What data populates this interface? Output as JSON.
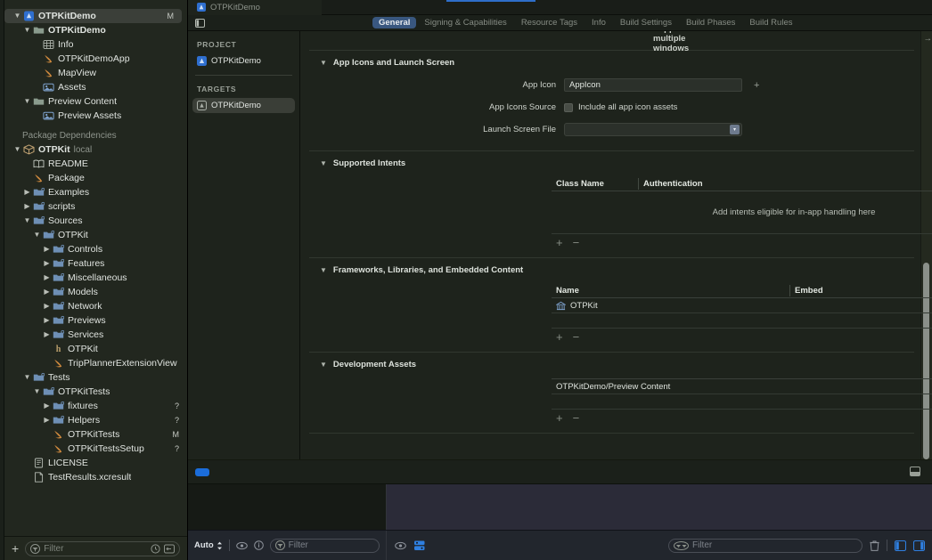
{
  "window": {
    "title": "OTPKitDemo"
  },
  "navigator": {
    "items": [
      {
        "disc": "v",
        "indent": 0,
        "icon": "app-project-icon",
        "label": "OTPKitDemo",
        "status": "M",
        "selected": true,
        "bold": true
      },
      {
        "disc": "v",
        "indent": 1,
        "icon": "folder-icon",
        "label": "OTPKitDemo",
        "status": "",
        "selected": false,
        "bold": true
      },
      {
        "disc": "",
        "indent": 2,
        "icon": "plist-icon",
        "label": "Info",
        "status": "",
        "selected": false,
        "bold": false
      },
      {
        "disc": "",
        "indent": 2,
        "icon": "swift-icon",
        "label": "OTPKitDemoApp",
        "status": "",
        "selected": false,
        "bold": false
      },
      {
        "disc": "",
        "indent": 2,
        "icon": "swift-icon",
        "label": "MapView",
        "status": "",
        "selected": false,
        "bold": false
      },
      {
        "disc": "",
        "indent": 2,
        "icon": "assets-icon",
        "label": "Assets",
        "status": "",
        "selected": false,
        "bold": false
      },
      {
        "disc": "v",
        "indent": 1,
        "icon": "folder-icon",
        "label": "Preview Content",
        "status": "",
        "selected": false,
        "bold": false
      },
      {
        "disc": "",
        "indent": 2,
        "icon": "assets-icon",
        "label": "Preview Assets",
        "status": "",
        "selected": false,
        "bold": false
      },
      {
        "disc": "",
        "indent": 0,
        "icon": "none",
        "label": "Package Dependencies",
        "status": "",
        "selected": false,
        "bold": true,
        "dim": true,
        "spacer": true
      },
      {
        "disc": "v",
        "indent": 0,
        "icon": "package-icon",
        "label": "OTPKit",
        "sub": "local",
        "status": "",
        "selected": false,
        "bold": true
      },
      {
        "disc": "",
        "indent": 1,
        "icon": "readme-icon",
        "label": "README",
        "status": "",
        "selected": false,
        "bold": false
      },
      {
        "disc": "",
        "indent": 1,
        "icon": "swift-icon",
        "label": "Package",
        "status": "",
        "selected": false,
        "bold": false
      },
      {
        "disc": ">",
        "indent": 1,
        "icon": "swift-folder-icon",
        "label": "Examples",
        "status": "",
        "selected": false,
        "bold": false
      },
      {
        "disc": ">",
        "indent": 1,
        "icon": "swift-folder-icon",
        "label": "scripts",
        "status": "",
        "selected": false,
        "bold": false
      },
      {
        "disc": "v",
        "indent": 1,
        "icon": "swift-folder-icon",
        "label": "Sources",
        "status": "",
        "selected": false,
        "bold": false
      },
      {
        "disc": "v",
        "indent": 2,
        "icon": "swift-folder-icon",
        "label": "OTPKit",
        "status": "",
        "selected": false,
        "bold": false
      },
      {
        "disc": ">",
        "indent": 3,
        "icon": "swift-folder-icon",
        "label": "Controls",
        "status": "",
        "selected": false,
        "bold": false
      },
      {
        "disc": ">",
        "indent": 3,
        "icon": "swift-folder-icon",
        "label": "Features",
        "status": "",
        "selected": false,
        "bold": false
      },
      {
        "disc": ">",
        "indent": 3,
        "icon": "swift-folder-icon",
        "label": "Miscellaneous",
        "status": "",
        "selected": false,
        "bold": false
      },
      {
        "disc": ">",
        "indent": 3,
        "icon": "swift-folder-icon",
        "label": "Models",
        "status": "",
        "selected": false,
        "bold": false
      },
      {
        "disc": ">",
        "indent": 3,
        "icon": "swift-folder-icon",
        "label": "Network",
        "status": "",
        "selected": false,
        "bold": false
      },
      {
        "disc": ">",
        "indent": 3,
        "icon": "swift-folder-icon",
        "label": "Previews",
        "status": "",
        "selected": false,
        "bold": false
      },
      {
        "disc": ">",
        "indent": 3,
        "icon": "swift-folder-icon",
        "label": "Services",
        "status": "",
        "selected": false,
        "bold": false
      },
      {
        "disc": "",
        "indent": 3,
        "icon": "header-icon",
        "label": "OTPKit",
        "status": "",
        "selected": false,
        "bold": false
      },
      {
        "disc": "",
        "indent": 3,
        "icon": "swift-icon",
        "label": "TripPlannerExtensionView",
        "status": "",
        "selected": false,
        "bold": false
      },
      {
        "disc": "v",
        "indent": 1,
        "icon": "swift-folder-icon",
        "label": "Tests",
        "status": "",
        "selected": false,
        "bold": false
      },
      {
        "disc": "v",
        "indent": 2,
        "icon": "swift-folder-icon",
        "label": "OTPKitTests",
        "status": "",
        "selected": false,
        "bold": false
      },
      {
        "disc": ">",
        "indent": 3,
        "icon": "swift-folder-icon",
        "label": "fixtures",
        "status": "?",
        "selected": false,
        "bold": false
      },
      {
        "disc": ">",
        "indent": 3,
        "icon": "swift-folder-icon",
        "label": "Helpers",
        "status": "?",
        "selected": false,
        "bold": false
      },
      {
        "disc": "",
        "indent": 3,
        "icon": "swift-icon",
        "label": "OTPKitTests",
        "status": "M",
        "selected": false,
        "bold": false
      },
      {
        "disc": "",
        "indent": 3,
        "icon": "swift-icon",
        "label": "OTPKitTestsSetup",
        "status": "?",
        "selected": false,
        "bold": false
      },
      {
        "disc": "",
        "indent": 1,
        "icon": "license-icon",
        "label": "LICENSE",
        "status": "",
        "selected": false,
        "bold": false
      },
      {
        "disc": "",
        "indent": 1,
        "icon": "file-icon",
        "label": "TestResults.xcresult",
        "status": "",
        "selected": false,
        "bold": false
      }
    ],
    "bottom": {
      "add_label": "+",
      "filter_placeholder": "Filter",
      "clock_icon": "clock-icon",
      "collapse_icon": "collapse-icon"
    }
  },
  "editor": {
    "tab_label": "OTPKitDemo",
    "tabs": [
      {
        "label": "General",
        "active": true
      },
      {
        "label": "Signing & Capabilities",
        "active": false
      },
      {
        "label": "Resource Tags",
        "active": false
      },
      {
        "label": "Info",
        "active": false
      },
      {
        "label": "Build Settings",
        "active": false
      },
      {
        "label": "Build Phases",
        "active": false
      },
      {
        "label": "Build Rules",
        "active": false
      }
    ]
  },
  "project_list": {
    "project_header": "PROJECT",
    "project_item": "OTPKitDemo",
    "targets_header": "TARGETS",
    "target_item": "OTPKitDemo",
    "bottom": {
      "add_label": "+",
      "remove_label": "−",
      "filter_placeholder": "Filter"
    }
  },
  "content": {
    "partial_row_label": "Supports multiple windows",
    "sections": {
      "app_icons": {
        "title": "App Icons and Launch Screen",
        "app_icon_label": "App Icon",
        "app_icon_value": "AppIcon",
        "app_icons_source_label": "App Icons Source",
        "include_all_label": "Include all app icon assets",
        "launch_screen_label": "Launch Screen File",
        "launch_screen_value": ""
      },
      "supported_intents": {
        "title": "Supported Intents",
        "columns": [
          "Class Name",
          "Authentication"
        ],
        "empty_text": "Add intents eligible for in-app handling here",
        "add_label": "+",
        "remove_label": "−"
      },
      "frameworks": {
        "title": "Frameworks, Libraries, and Embedded Content",
        "columns": [
          "Name",
          "Embed"
        ],
        "rows": [
          {
            "name": "OTPKit",
            "embed": ""
          }
        ],
        "add_label": "+",
        "remove_label": "−"
      },
      "development_assets": {
        "title": "Development Assets",
        "rows": [
          "OTPKitDemo/Preview Content"
        ],
        "add_label": "+",
        "remove_label": "−"
      }
    }
  },
  "bottom_bar": {
    "auto_label": "Auto",
    "left_filter_placeholder": "Filter",
    "right_filter_placeholder": "Filter",
    "eye_icon": "eye-icon",
    "info_icon": "info-circle-icon",
    "variables_icon": "variables-view-icon",
    "trash_icon": "trash-icon",
    "left_panel_icon": "left-panel-toggle-icon",
    "right_panel_icon": "right-panel-toggle-icon"
  },
  "colors": {
    "accent_blue": "#2e6ec9",
    "tab_active_bg": "#39577f",
    "nav_bg": "#22271f",
    "editor_bg": "#1e231c",
    "debug_bg": "#2b2b38",
    "swift_orange": "#d08a3e",
    "folder_blue": "#6e8fb5"
  }
}
